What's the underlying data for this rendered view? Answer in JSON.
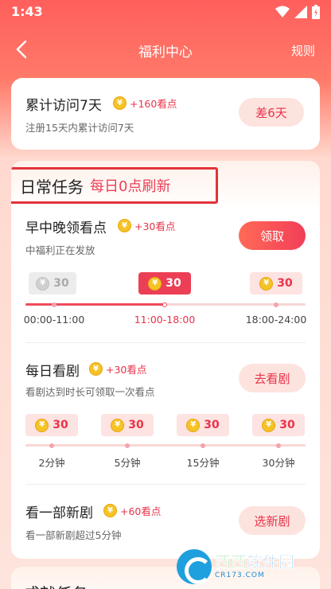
{
  "status_bar": {
    "time": "1:43"
  },
  "header": {
    "title": "福利中心",
    "rules": "规则"
  },
  "cumulative_task": {
    "title": "累计访问7天",
    "reward": "+160看点",
    "desc": "注册15天内累计访问7天",
    "button": "差6天"
  },
  "daily_section": {
    "title": "日常任务",
    "subtitle": "每日0点刷新"
  },
  "meal_task": {
    "title": "早中晚领看点",
    "reward": "+30看点",
    "desc": "中福利正在发放",
    "button": "领取",
    "slots": [
      {
        "amount": "30",
        "label": "00:00-11:00",
        "state": "done"
      },
      {
        "amount": "30",
        "label": "11:00-18:00",
        "state": "active"
      },
      {
        "amount": "30",
        "label": "18:00-24:00",
        "state": "pending"
      }
    ]
  },
  "watch_task": {
    "title": "每日看剧",
    "reward": "+30看点",
    "desc": "看剧达到时长可领取一次看点",
    "button": "去看剧",
    "slots": [
      {
        "amount": "30",
        "label": "2分钟"
      },
      {
        "amount": "30",
        "label": "5分钟"
      },
      {
        "amount": "30",
        "label": "15分钟"
      },
      {
        "amount": "30",
        "label": "30分钟"
      }
    ]
  },
  "new_drama_task": {
    "title": "看一部新剧",
    "reward": "+60看点",
    "desc": "看一部新剧超过5分钟",
    "button": "选新剧"
  },
  "bottom_section": {
    "title": "成就任务"
  },
  "coin_symbol": "¥",
  "watermark": {
    "main_a": "西西",
    "main_b": "软件园",
    "sub": "CR173.COM"
  },
  "colors": {
    "accent": "#e8334a",
    "header_bg": "#ff5f5c",
    "coin": "#f6c327"
  }
}
